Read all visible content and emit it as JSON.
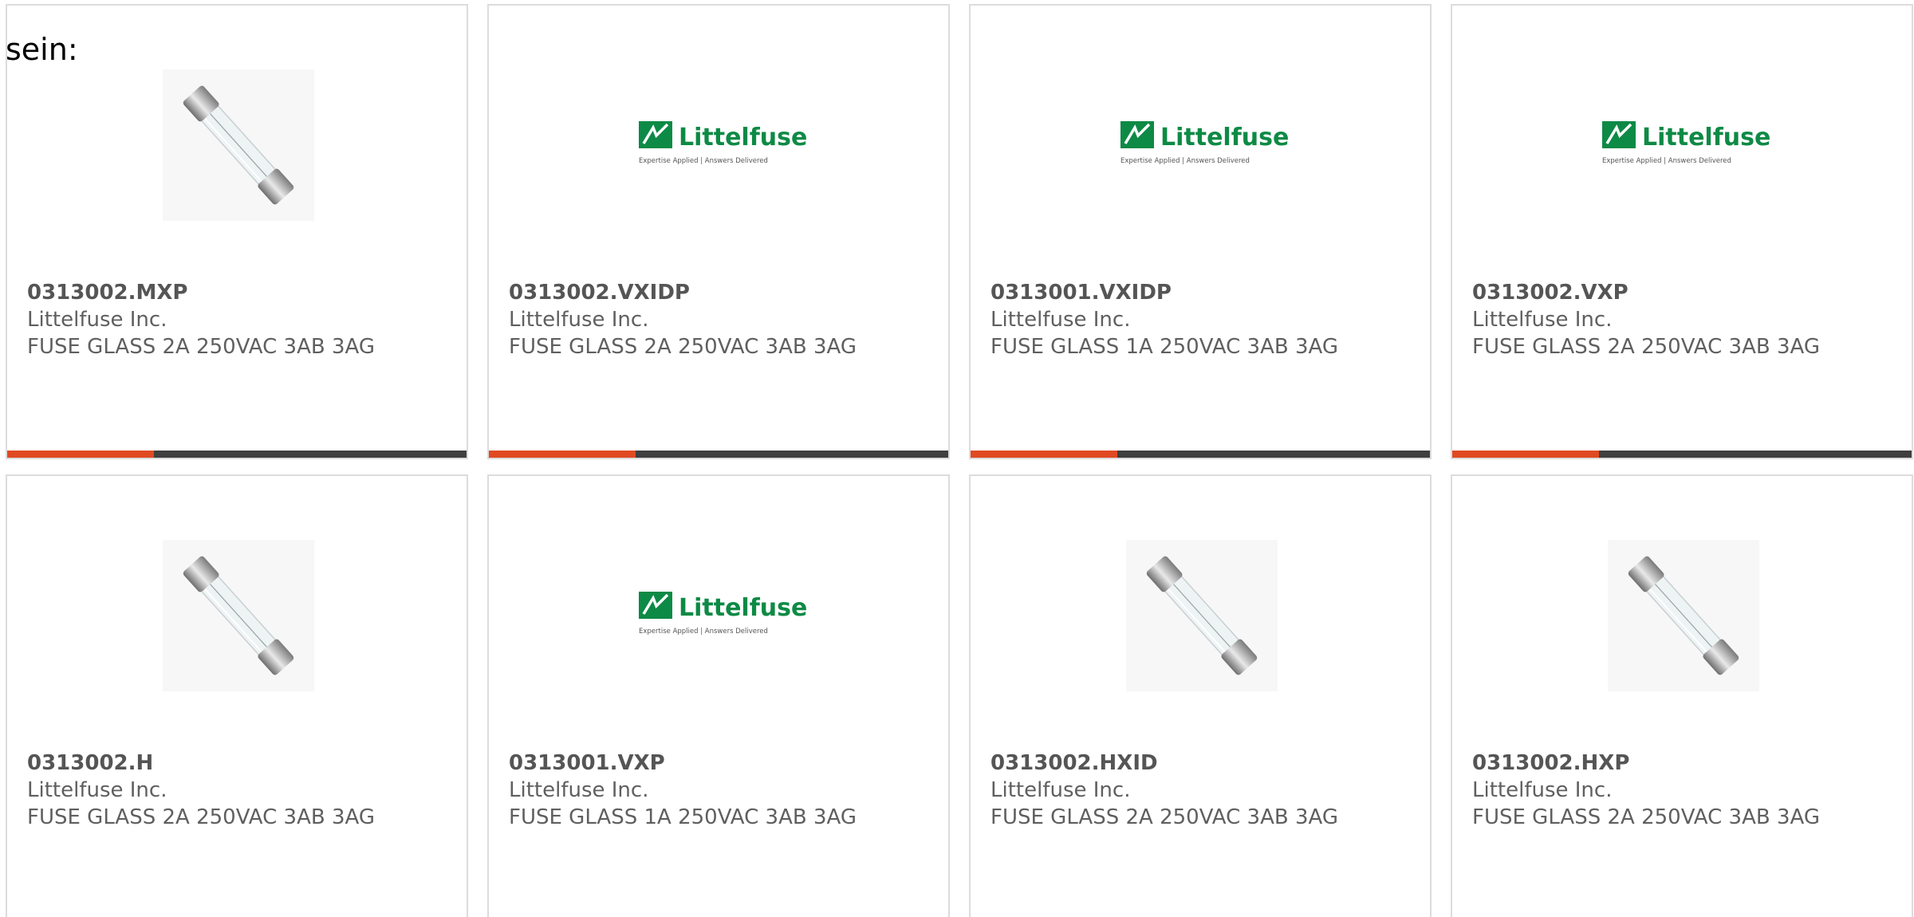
{
  "intro_text": "sein:",
  "colors": {
    "accent": "#e04a23",
    "bar_track": "#3f3f3f",
    "brand_green": "#0d8a45",
    "text": "#5f5f5f"
  },
  "products": [
    {
      "part": "0313002.MXP",
      "maker": "Littelfuse Inc.",
      "desc": "FUSE GLASS 2A 250VAC 3AB 3AG",
      "image": "fuse-photo",
      "progress": 0.32
    },
    {
      "part": "0313002.VXIDP",
      "maker": "Littelfuse Inc.",
      "desc": "FUSE GLASS 2A 250VAC 3AB 3AG",
      "image": "littelfuse-logo",
      "progress": 0.32
    },
    {
      "part": "0313001.VXIDP",
      "maker": "Littelfuse Inc.",
      "desc": "FUSE GLASS 1A 250VAC 3AB 3AG",
      "image": "littelfuse-logo",
      "progress": 0.32
    },
    {
      "part": "0313002.VXP",
      "maker": "Littelfuse Inc.",
      "desc": "FUSE GLASS 2A 250VAC 3AB 3AG",
      "image": "littelfuse-logo",
      "progress": 0.32
    },
    {
      "part": "0313002.H",
      "maker": "Littelfuse Inc.",
      "desc": "FUSE GLASS 2A 250VAC 3AB 3AG",
      "image": "fuse-photo"
    },
    {
      "part": "0313001.VXP",
      "maker": "Littelfuse Inc.",
      "desc": "FUSE GLASS 1A 250VAC 3AB 3AG",
      "image": "littelfuse-logo"
    },
    {
      "part": "0313002.HXID",
      "maker": "Littelfuse Inc.",
      "desc": "FUSE GLASS 2A 250VAC 3AB 3AG",
      "image": "fuse-photo"
    },
    {
      "part": "0313002.HXP",
      "maker": "Littelfuse Inc.",
      "desc": "FUSE GLASS 2A 250VAC 3AB 3AG",
      "image": "fuse-photo"
    }
  ],
  "logo": {
    "brand": "Littelfuse",
    "tagline": "Expertise Applied | Answers Delivered"
  }
}
